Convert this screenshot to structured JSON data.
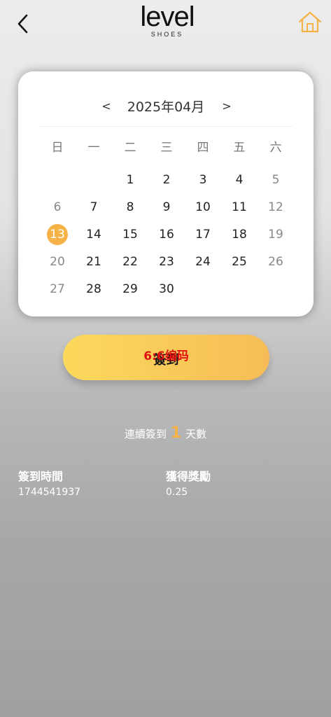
{
  "header": {
    "logo_main": "level",
    "logo_sub": "SHOES"
  },
  "calendar": {
    "title": "2025年04月",
    "prev_label": "<",
    "next_label": ">",
    "weekdays": [
      "日",
      "一",
      "二",
      "三",
      "四",
      "五",
      "六"
    ],
    "days": [
      "",
      "",
      "1",
      "2",
      "3",
      "4",
      "5",
      "6",
      "7",
      "8",
      "9",
      "10",
      "11",
      "12",
      "13",
      "14",
      "15",
      "16",
      "17",
      "18",
      "19",
      "20",
      "21",
      "22",
      "23",
      "24",
      "25",
      "26",
      "27",
      "28",
      "29",
      "30"
    ],
    "today": "13"
  },
  "checkin": {
    "label": "簽到",
    "overlay": "6:6编码"
  },
  "streak": {
    "prefix": "連續簽到",
    "count": "1",
    "suffix": "天數"
  },
  "records": {
    "time_header": "簽到時間",
    "time_value": "1744541937",
    "reward_header": "獲得獎勵",
    "reward_value": "0.25"
  },
  "colors": {
    "accent": "#f5b347",
    "button_start": "#fbd95c",
    "button_end": "#f6bc57",
    "overlay_text": "#e01010"
  }
}
